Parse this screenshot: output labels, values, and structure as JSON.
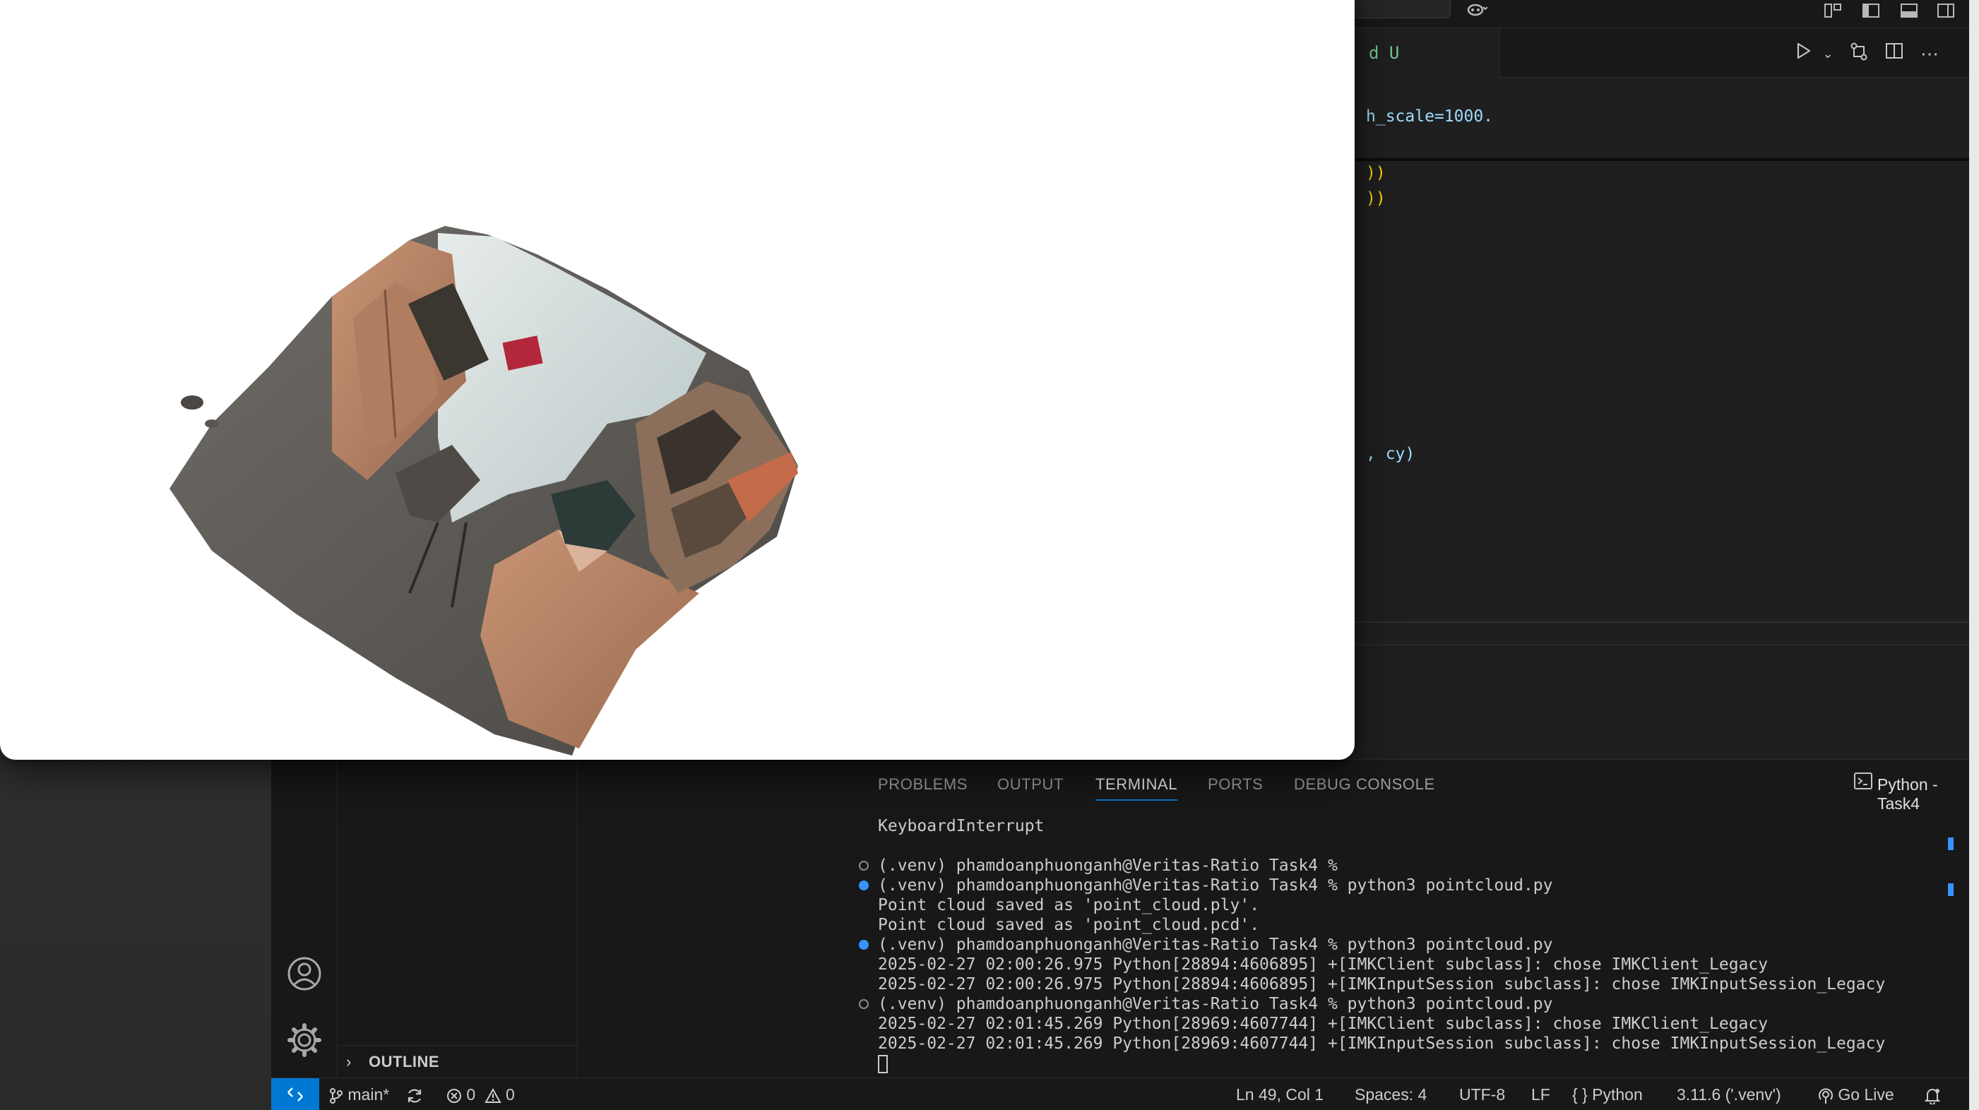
{
  "editor": {
    "tab_fragment": "d U",
    "code_lines": [
      {
        "text": "h_scale=1000."
      },
      {
        "text": "))"
      },
      {
        "text": "))"
      },
      {
        "text": ", cy)"
      }
    ]
  },
  "sidebar": {
    "outline_label": "OUTLINE"
  },
  "panel": {
    "tabs": [
      {
        "label": "PROBLEMS",
        "active": false
      },
      {
        "label": "OUTPUT",
        "active": false
      },
      {
        "label": "TERMINAL",
        "active": true
      },
      {
        "label": "PORTS",
        "active": false
      },
      {
        "label": "DEBUG CONSOLE",
        "active": false
      }
    ],
    "terminal_name": "Python - Task4"
  },
  "terminal": {
    "lines": [
      {
        "text": "KeyboardInterrupt",
        "dot": "none"
      },
      {
        "text": "",
        "dot": "none"
      },
      {
        "text": "(.venv) phamdoanphuonganh@Veritas-Ratio Task4 %",
        "dot": "hollow"
      },
      {
        "text": "(.venv) phamdoanphuonganh@Veritas-Ratio Task4 % python3 pointcloud.py",
        "dot": "blue"
      },
      {
        "text": "Point cloud saved as 'point_cloud.ply'.",
        "dot": "none"
      },
      {
        "text": "Point cloud saved as 'point_cloud.pcd'.",
        "dot": "none"
      },
      {
        "text": "(.venv) phamdoanphuonganh@Veritas-Ratio Task4 % python3 pointcloud.py",
        "dot": "blue"
      },
      {
        "text": "2025-02-27 02:00:26.975 Python[28894:4606895] +[IMKClient subclass]: chose IMKClient_Legacy",
        "dot": "none"
      },
      {
        "text": "2025-02-27 02:00:26.975 Python[28894:4606895] +[IMKInputSession subclass]: chose IMKInputSession_Legacy",
        "dot": "none"
      },
      {
        "text": "(.venv) phamdoanphuonganh@Veritas-Ratio Task4 % python3 pointcloud.py",
        "dot": "hollow"
      },
      {
        "text": "2025-02-27 02:01:45.269 Python[28969:4607744] +[IMKClient subclass]: chose IMKClient_Legacy",
        "dot": "none"
      },
      {
        "text": "2025-02-27 02:01:45.269 Python[28969:4607744] +[IMKInputSession subclass]: chose IMKInputSession_Legacy",
        "dot": "none"
      }
    ]
  },
  "statusbar": {
    "branch": "main*",
    "errors": "0",
    "warnings": "0",
    "cursor_pos": "Ln 49, Col 1",
    "spaces": "Spaces: 4",
    "encoding": "UTF-8",
    "eol": "LF",
    "language": "Python",
    "interpreter": "3.11.6 ('.venv')",
    "go_live": "Go Live"
  },
  "colors": {
    "accent": "#0078d4",
    "terminal_blue_dot": "#3794ff",
    "git_modified": "#73c991"
  }
}
